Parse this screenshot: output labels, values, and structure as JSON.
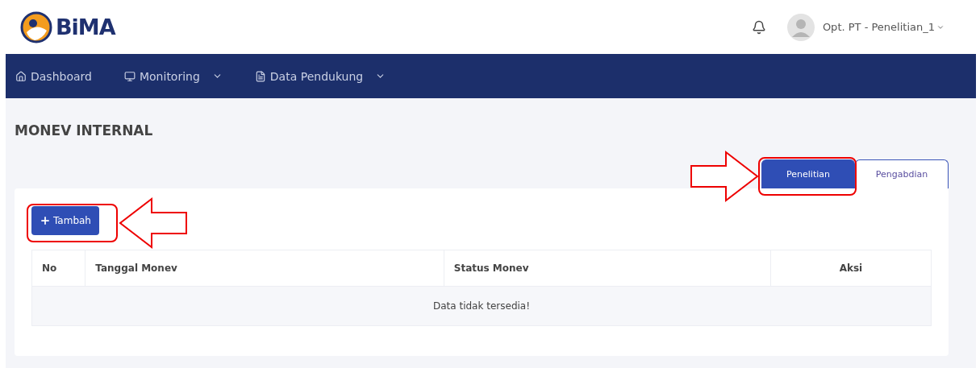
{
  "header": {
    "logo_text": "BiMA",
    "user_name": "Opt. PT - Penelitian_1"
  },
  "nav": [
    {
      "label": "Dashboard",
      "dropdown": false
    },
    {
      "label": "Monitoring",
      "dropdown": true
    },
    {
      "label": "Data Pendukung",
      "dropdown": true
    }
  ],
  "page_title": "MONEV INTERNAL",
  "tabs": [
    {
      "label": "Penelitian",
      "selected": true
    },
    {
      "label": "Pengabdian",
      "selected": false
    }
  ],
  "add_button": "Tambah",
  "table": {
    "columns": [
      "No",
      "Tanggal Monev",
      "Status Monev",
      "Aksi"
    ],
    "empty_message": "Data tidak tersedia!"
  }
}
